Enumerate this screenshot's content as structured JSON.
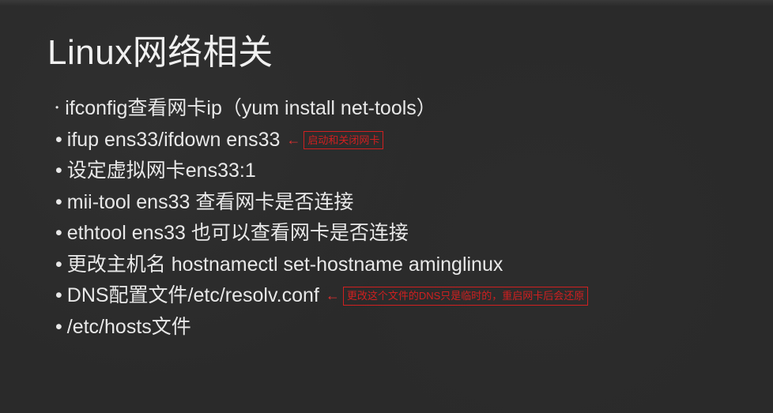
{
  "title": "Linux网络相关",
  "bullets": [
    {
      "marker": "•",
      "small": true,
      "text": "ifconfig查看网卡ip（yum install net-tools）",
      "annotation": null
    },
    {
      "marker": "•",
      "small": false,
      "text": "ifup ens33/ifdown ens33",
      "annotation": "启动和关闭网卡"
    },
    {
      "marker": "•",
      "small": false,
      "text": "设定虚拟网卡ens33:1",
      "annotation": null
    },
    {
      "marker": "•",
      "small": false,
      "text": "mii-tool ens33 查看网卡是否连接",
      "annotation": null
    },
    {
      "marker": "•",
      "small": false,
      "text": "ethtool ens33 也可以查看网卡是否连接",
      "annotation": null
    },
    {
      "marker": "•",
      "small": false,
      "text": "更改主机名 hostnamectl set-hostname aminglinux",
      "annotation": null
    },
    {
      "marker": "•",
      "small": false,
      "text": "DNS配置文件/etc/resolv.conf",
      "annotation": "更改这个文件的DNS只是临时的，重启网卡后会还原"
    },
    {
      "marker": "•",
      "small": false,
      "text": "/etc/hosts文件",
      "annotation": null
    }
  ],
  "arrow_glyph": "←"
}
